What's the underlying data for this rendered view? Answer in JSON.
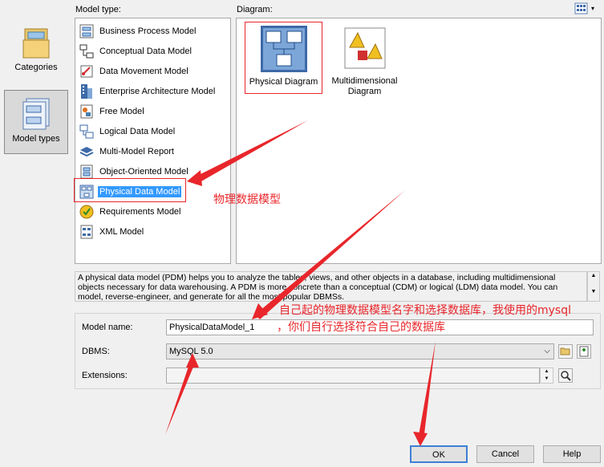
{
  "left_nav": {
    "items": [
      {
        "label": "Categories",
        "selected": false,
        "icon": "folder-icon"
      },
      {
        "label": "Model types",
        "selected": true,
        "icon": "model-types-icon"
      }
    ]
  },
  "model_type": {
    "label": "Model type:",
    "items": [
      {
        "label": "Business Process Model",
        "icon": "business-process-icon"
      },
      {
        "label": "Conceptual Data Model",
        "icon": "conceptual-data-icon"
      },
      {
        "label": "Data Movement Model",
        "icon": "data-movement-icon"
      },
      {
        "label": "Enterprise Architecture Model",
        "icon": "enterprise-architecture-icon"
      },
      {
        "label": "Free Model",
        "icon": "free-model-icon"
      },
      {
        "label": "Logical Data Model",
        "icon": "logical-data-icon"
      },
      {
        "label": "Multi-Model Report",
        "icon": "multi-model-report-icon"
      },
      {
        "label": "Object-Oriented Model",
        "icon": "object-oriented-icon"
      },
      {
        "label": "Physical Data Model",
        "icon": "physical-data-icon",
        "selected": true
      },
      {
        "label": "Requirements Model",
        "icon": "requirements-icon"
      },
      {
        "label": "XML Model",
        "icon": "xml-model-icon"
      }
    ]
  },
  "diagram": {
    "label": "Diagram:",
    "items": [
      {
        "label": "Physical Diagram",
        "selected": true,
        "icon": "physical-diagram-icon"
      },
      {
        "label": "Multidimensional Diagram",
        "selected": false,
        "icon": "multidimensional-diagram-icon"
      }
    ]
  },
  "description": "A physical data model (PDM) helps you to analyze the tables, views, and other objects in a database, including multidimensional objects necessary for data warehousing. A PDM is more concrete than a conceptual (CDM) or logical (LDM) data model. You can model, reverse-engineer, and generate for all the most popular DBMSs.",
  "form": {
    "model_name_label": "Model name:",
    "model_name_value": "PhysicalDataModel_1",
    "dbms_label": "DBMS:",
    "dbms_value": "MySQL 5.0",
    "extensions_label": "Extensions:",
    "extensions_value": ""
  },
  "buttons": {
    "ok": "OK",
    "cancel": "Cancel",
    "help": "Help"
  },
  "annotations": {
    "pdm_note": "物理数据模型",
    "name_note_line1": "自己起的物理数据模型名字和选择数据库，我使用的mysql",
    "name_note_line2": "，你们自行选择符合自己的数据库"
  },
  "colors": {
    "selection": "#3399ff",
    "annotation": "#e8262b"
  }
}
